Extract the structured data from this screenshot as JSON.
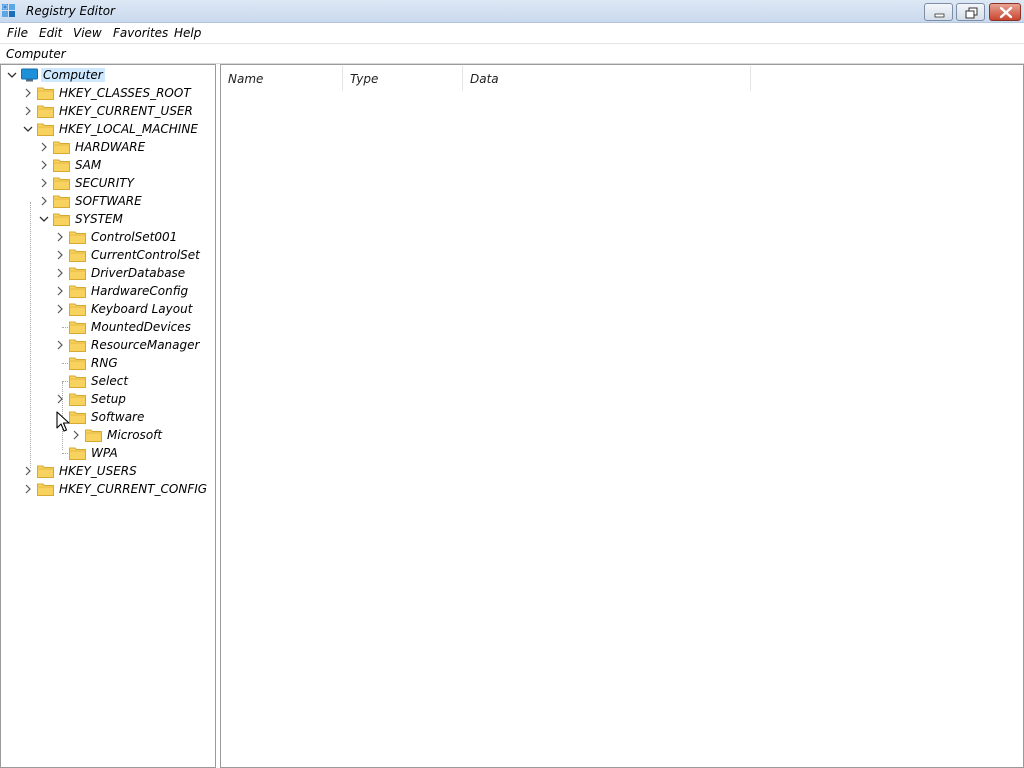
{
  "window": {
    "title": "Registry Editor"
  },
  "menu": {
    "file": "File",
    "edit": "Edit",
    "view": "View",
    "favorites": "Favorites",
    "help": "Help"
  },
  "address": {
    "path": "Computer"
  },
  "tree": {
    "root": "Computer",
    "hives": [
      "HKEY_CLASSES_ROOT",
      "HKEY_CURRENT_USER",
      "HKEY_LOCAL_MACHINE",
      "HKEY_USERS",
      "HKEY_CURRENT_CONFIG"
    ],
    "hklm_children": [
      "HARDWARE",
      "SAM",
      "SECURITY",
      "SOFTWARE",
      "SYSTEM"
    ],
    "system_children": [
      "ControlSet001",
      "CurrentControlSet",
      "DriverDatabase",
      "HardwareConfig",
      "Keyboard Layout",
      "MountedDevices",
      "ResourceManager",
      "RNG",
      "Select",
      "Setup",
      "Software",
      "WPA"
    ],
    "software_children": [
      "Microsoft"
    ]
  },
  "columns": {
    "name": "Name",
    "type": "Type",
    "data": "Data"
  },
  "colors": {
    "folder": "#f8d25e",
    "selection": "#cde8ff",
    "computer_icon": "#1f8fd8"
  }
}
